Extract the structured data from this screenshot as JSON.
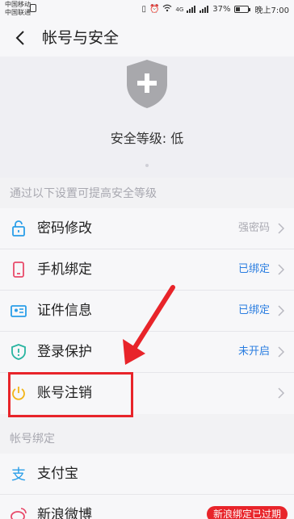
{
  "status_bar": {
    "carrier_1": "中国移动",
    "carrier_2": "中国联通",
    "battery": "37%",
    "time": "晚上7:00",
    "network": "4G"
  },
  "nav": {
    "title": "帐号与安全"
  },
  "security": {
    "level_text": "安全等级: 低"
  },
  "sections": {
    "improve_label": "通过以下设置可提高安全等级",
    "binding_label": "帐号绑定"
  },
  "settings": [
    {
      "label": "密码修改",
      "value": "强密码",
      "value_color": "#aaaab2",
      "icon": "lock-icon"
    },
    {
      "label": "手机绑定",
      "value": "已绑定",
      "value_color": "#2a7de0",
      "icon": "phone-icon"
    },
    {
      "label": "证件信息",
      "value": "已绑定",
      "value_color": "#2a7de0",
      "icon": "id-card-icon"
    },
    {
      "label": "登录保护",
      "value": "未开启",
      "value_color": "#2a7de0",
      "icon": "shield-alert-icon"
    },
    {
      "label": "账号注销",
      "value": "",
      "icon": "power-icon"
    }
  ],
  "bindings": [
    {
      "label": "支付宝",
      "icon": "alipay-icon"
    },
    {
      "label": "新浪微博",
      "badge": "新浪绑定已过期",
      "icon": "weibo-icon"
    }
  ],
  "colors": {
    "accent_blue": "#2a7de0",
    "highlight_red": "#e8242a",
    "power_yellow": "#f2b418",
    "phone_red": "#e84a6a",
    "icon_blue": "#2a9ee8"
  }
}
